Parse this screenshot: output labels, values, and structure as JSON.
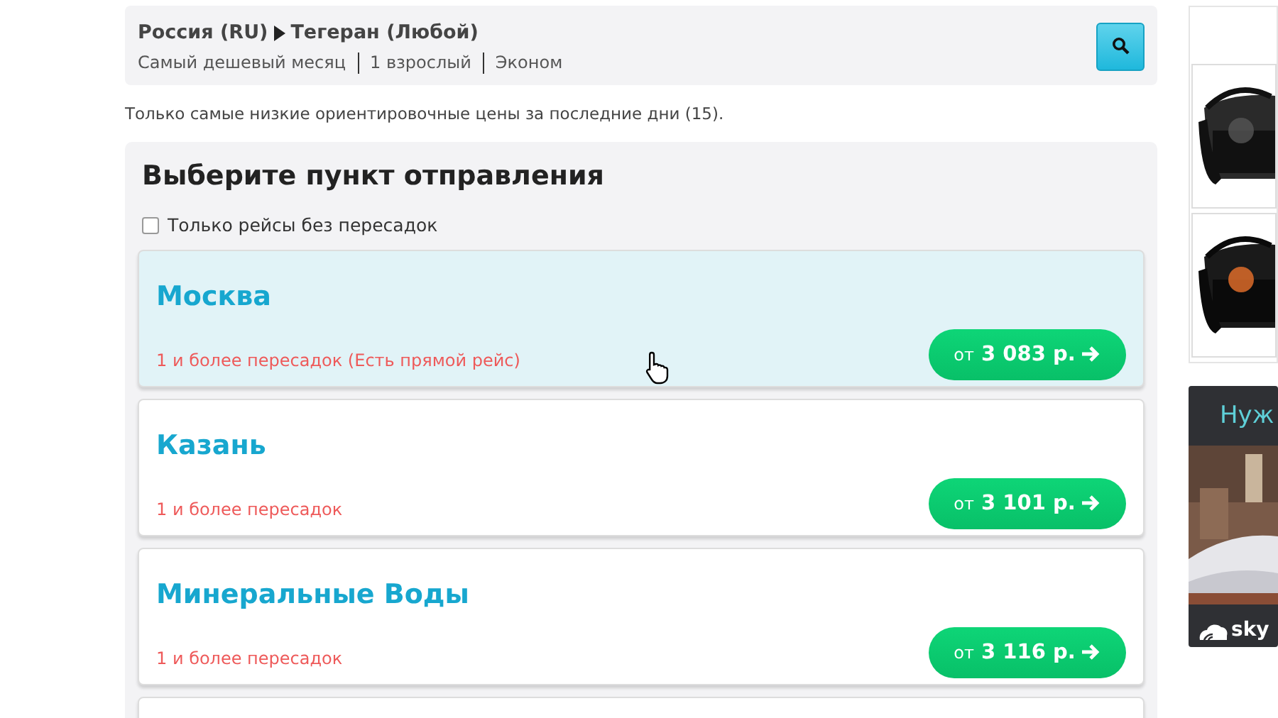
{
  "search_summary": {
    "origin": "Россия (RU)",
    "destination": "Тегеран (Любой)",
    "params": [
      "Самый дешевый месяц",
      "1 взрослый",
      "Эконом"
    ]
  },
  "note": "Только самые низкие ориентировочные цены за последние дни (15).",
  "panel": {
    "title": "Выберите пункт отправления",
    "direct_only": {
      "label": "Только рейсы без пересадок",
      "checked": false
    },
    "destinations": [
      {
        "city": "Москва",
        "stops": "1 и более пересадок (Есть прямой рейс)",
        "price_prefix": "от",
        "price": "3 083 р.",
        "hovered": true
      },
      {
        "city": "Казань",
        "stops": "1 и более пересадок",
        "price_prefix": "от",
        "price": "3 101 р.",
        "hovered": false
      },
      {
        "city": "Минеральные Воды",
        "stops": "1 и более пересадок",
        "price_prefix": "от",
        "price": "3 116 р.",
        "hovered": false
      }
    ]
  },
  "sidebar": {
    "banner": {
      "headline": "Нуж",
      "brand": "sky"
    }
  }
}
